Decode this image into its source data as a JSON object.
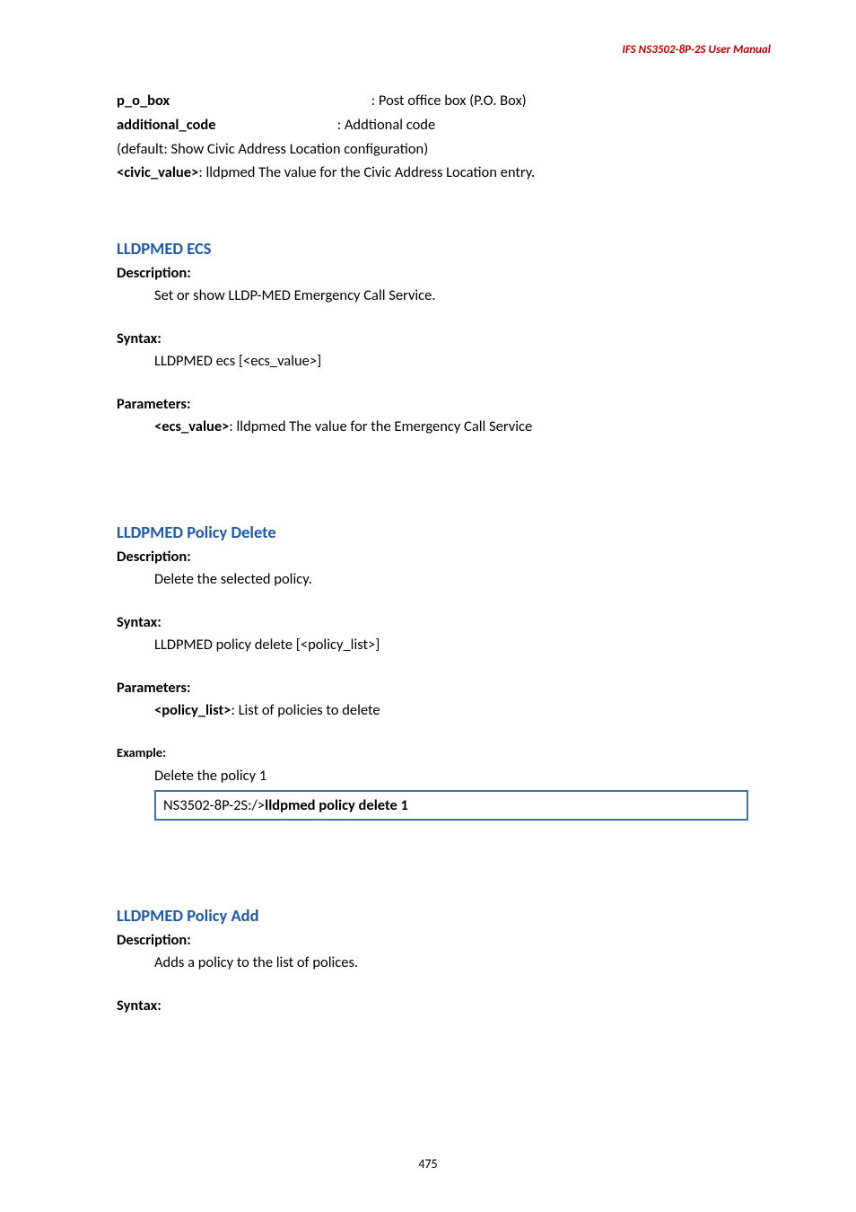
{
  "header": "IFS  NS3502-8P-2S  User  Manual",
  "top_params": {
    "p_o_box_label": "p_o_box",
    "p_o_box_value": ": Post office box (P.O. Box)",
    "additional_code_label": "additional_code",
    "additional_code_value": ": Addtional code",
    "default_line": "(default: Show Civic Address Location configuration)",
    "civic_value_label": "<civic_value>",
    "civic_value_text": ": lldpmed The value for the Civic Address Location entry."
  },
  "sections": {
    "ecs": {
      "title": "LLDPMED ECS",
      "description_label": "Description:",
      "description_text": "Set or show LLDP-MED Emergency Call Service.",
      "syntax_label": "Syntax:",
      "syntax_text": "LLDPMED ecs [<ecs_value>]",
      "parameters_label": "Parameters:",
      "param_bold": "<ecs_value>",
      "param_text": ": lldpmed The value for the Emergency Call Service"
    },
    "policy_delete": {
      "title": "LLDPMED Policy Delete",
      "description_label": "Description:",
      "description_text": "Delete the selected policy.",
      "syntax_label": "Syntax:",
      "syntax_text": "LLDPMED policy delete [<policy_list>]",
      "parameters_label": "Parameters:",
      "param_bold": "<policy_list>",
      "param_text": ": List of policies to delete",
      "example_label": "Example:",
      "example_text": "Delete the policy 1",
      "code_prefix": "NS3502-8P-2S:/>",
      "code_bold": "lldpmed policy delete 1"
    },
    "policy_add": {
      "title": "LLDPMED Policy Add",
      "description_label": "Description:",
      "description_text": "Adds a policy to the list of polices.",
      "syntax_label": "Syntax:"
    }
  },
  "page_number": "475"
}
